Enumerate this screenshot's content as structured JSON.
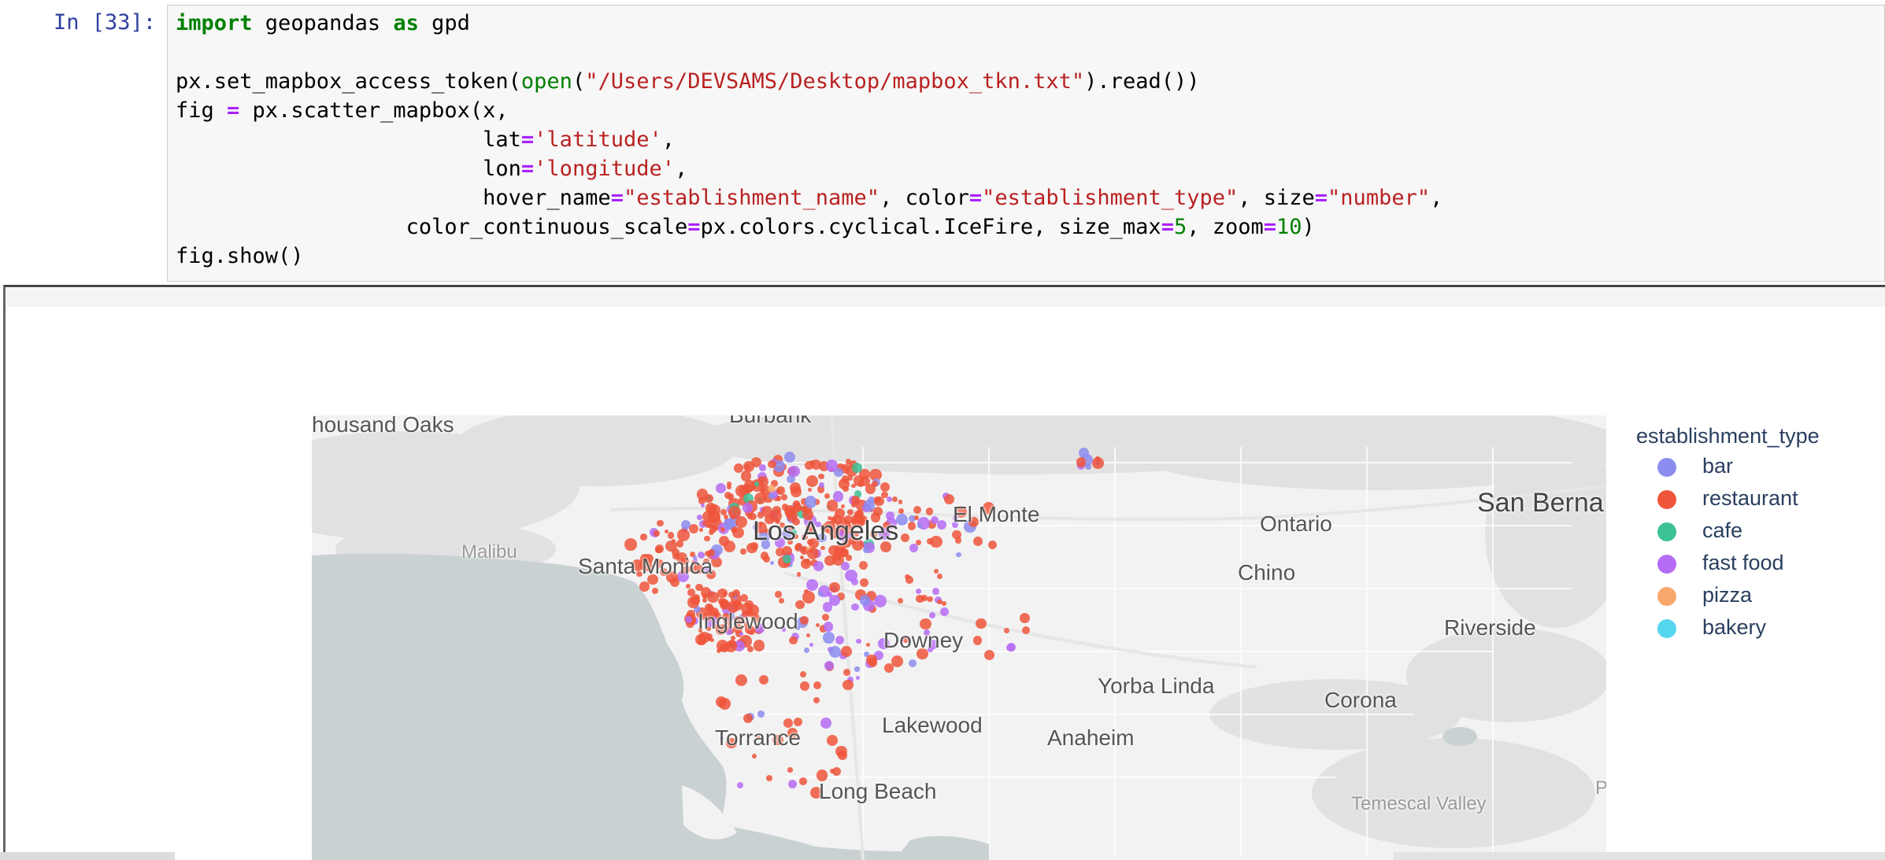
{
  "cell": {
    "prompt": "In [33]:",
    "code_lines": [
      [
        {
          "t": "import",
          "c": "kw"
        },
        {
          "t": " geopandas "
        },
        {
          "t": "as",
          "c": "kw"
        },
        {
          "t": " gpd"
        }
      ],
      [],
      [
        {
          "t": "px.set_mapbox_access_token("
        },
        {
          "t": "open",
          "c": "bi"
        },
        {
          "t": "("
        },
        {
          "t": "\"/Users/DEVSAMS/Desktop/mapbox_tkn.txt\"",
          "c": "st"
        },
        {
          "t": ").read())"
        }
      ],
      [
        {
          "t": "fig "
        },
        {
          "t": "=",
          "c": "op"
        },
        {
          "t": " px.scatter_mapbox(x,"
        }
      ],
      [
        {
          "t": "                        lat"
        },
        {
          "t": "=",
          "c": "op"
        },
        {
          "t": "'latitude'",
          "c": "st"
        },
        {
          "t": ","
        }
      ],
      [
        {
          "t": "                        lon"
        },
        {
          "t": "=",
          "c": "op"
        },
        {
          "t": "'longitude'",
          "c": "st"
        },
        {
          "t": ","
        }
      ],
      [
        {
          "t": "                        hover_name"
        },
        {
          "t": "=",
          "c": "op"
        },
        {
          "t": "\"establishment_name\"",
          "c": "st"
        },
        {
          "t": ", color"
        },
        {
          "t": "=",
          "c": "op"
        },
        {
          "t": "\"establishment_type\"",
          "c": "st"
        },
        {
          "t": ", size"
        },
        {
          "t": "=",
          "c": "op"
        },
        {
          "t": "\"number\"",
          "c": "st"
        },
        {
          "t": ","
        }
      ],
      [
        {
          "t": "                  color_continuous_scale"
        },
        {
          "t": "=",
          "c": "op"
        },
        {
          "t": "px.colors.cyclical.IceFire, size_max"
        },
        {
          "t": "=",
          "c": "op"
        },
        {
          "t": "5",
          "c": "nm"
        },
        {
          "t": ", zoom"
        },
        {
          "t": "=",
          "c": "op"
        },
        {
          "t": "10",
          "c": "nm"
        },
        {
          "t": ")"
        }
      ],
      [
        {
          "t": "fig.show()"
        }
      ]
    ]
  },
  "map": {
    "place_labels": {
      "thousand_oaks": "housand Oaks",
      "burbank": "Burbank",
      "malibu": "Malibu",
      "santa_monica": "Santa Monica",
      "los_angeles": "Los Angeles",
      "el_monte": "El Monte",
      "ontario": "Ontario",
      "san_bernardino": "San Berna",
      "chino": "Chino",
      "inglewood": "Inglewood",
      "downey": "Downey",
      "riverside": "Riverside",
      "yorba_linda": "Yorba Linda",
      "corona": "Corona",
      "torrance": "Torrance",
      "lakewood": "Lakewood",
      "anaheim": "Anaheim",
      "long_beach": "Long Beach",
      "temescal_valley": "Temescal Valley",
      "edge_p": "P"
    },
    "colors": {
      "land": "#f2f2f2",
      "water": "#c9d1d3",
      "hills": "#dcdcdc"
    }
  },
  "legend": {
    "title": "establishment_type",
    "items": [
      {
        "label": "bar",
        "color": "#8c8cf0"
      },
      {
        "label": "restaurant",
        "color": "#ef553b"
      },
      {
        "label": "cafe",
        "color": "#3cc296"
      },
      {
        "label": "fast food",
        "color": "#b56cf5"
      },
      {
        "label": "pizza",
        "color": "#f8a86c"
      },
      {
        "label": "bakery",
        "color": "#55d6ef"
      }
    ]
  }
}
